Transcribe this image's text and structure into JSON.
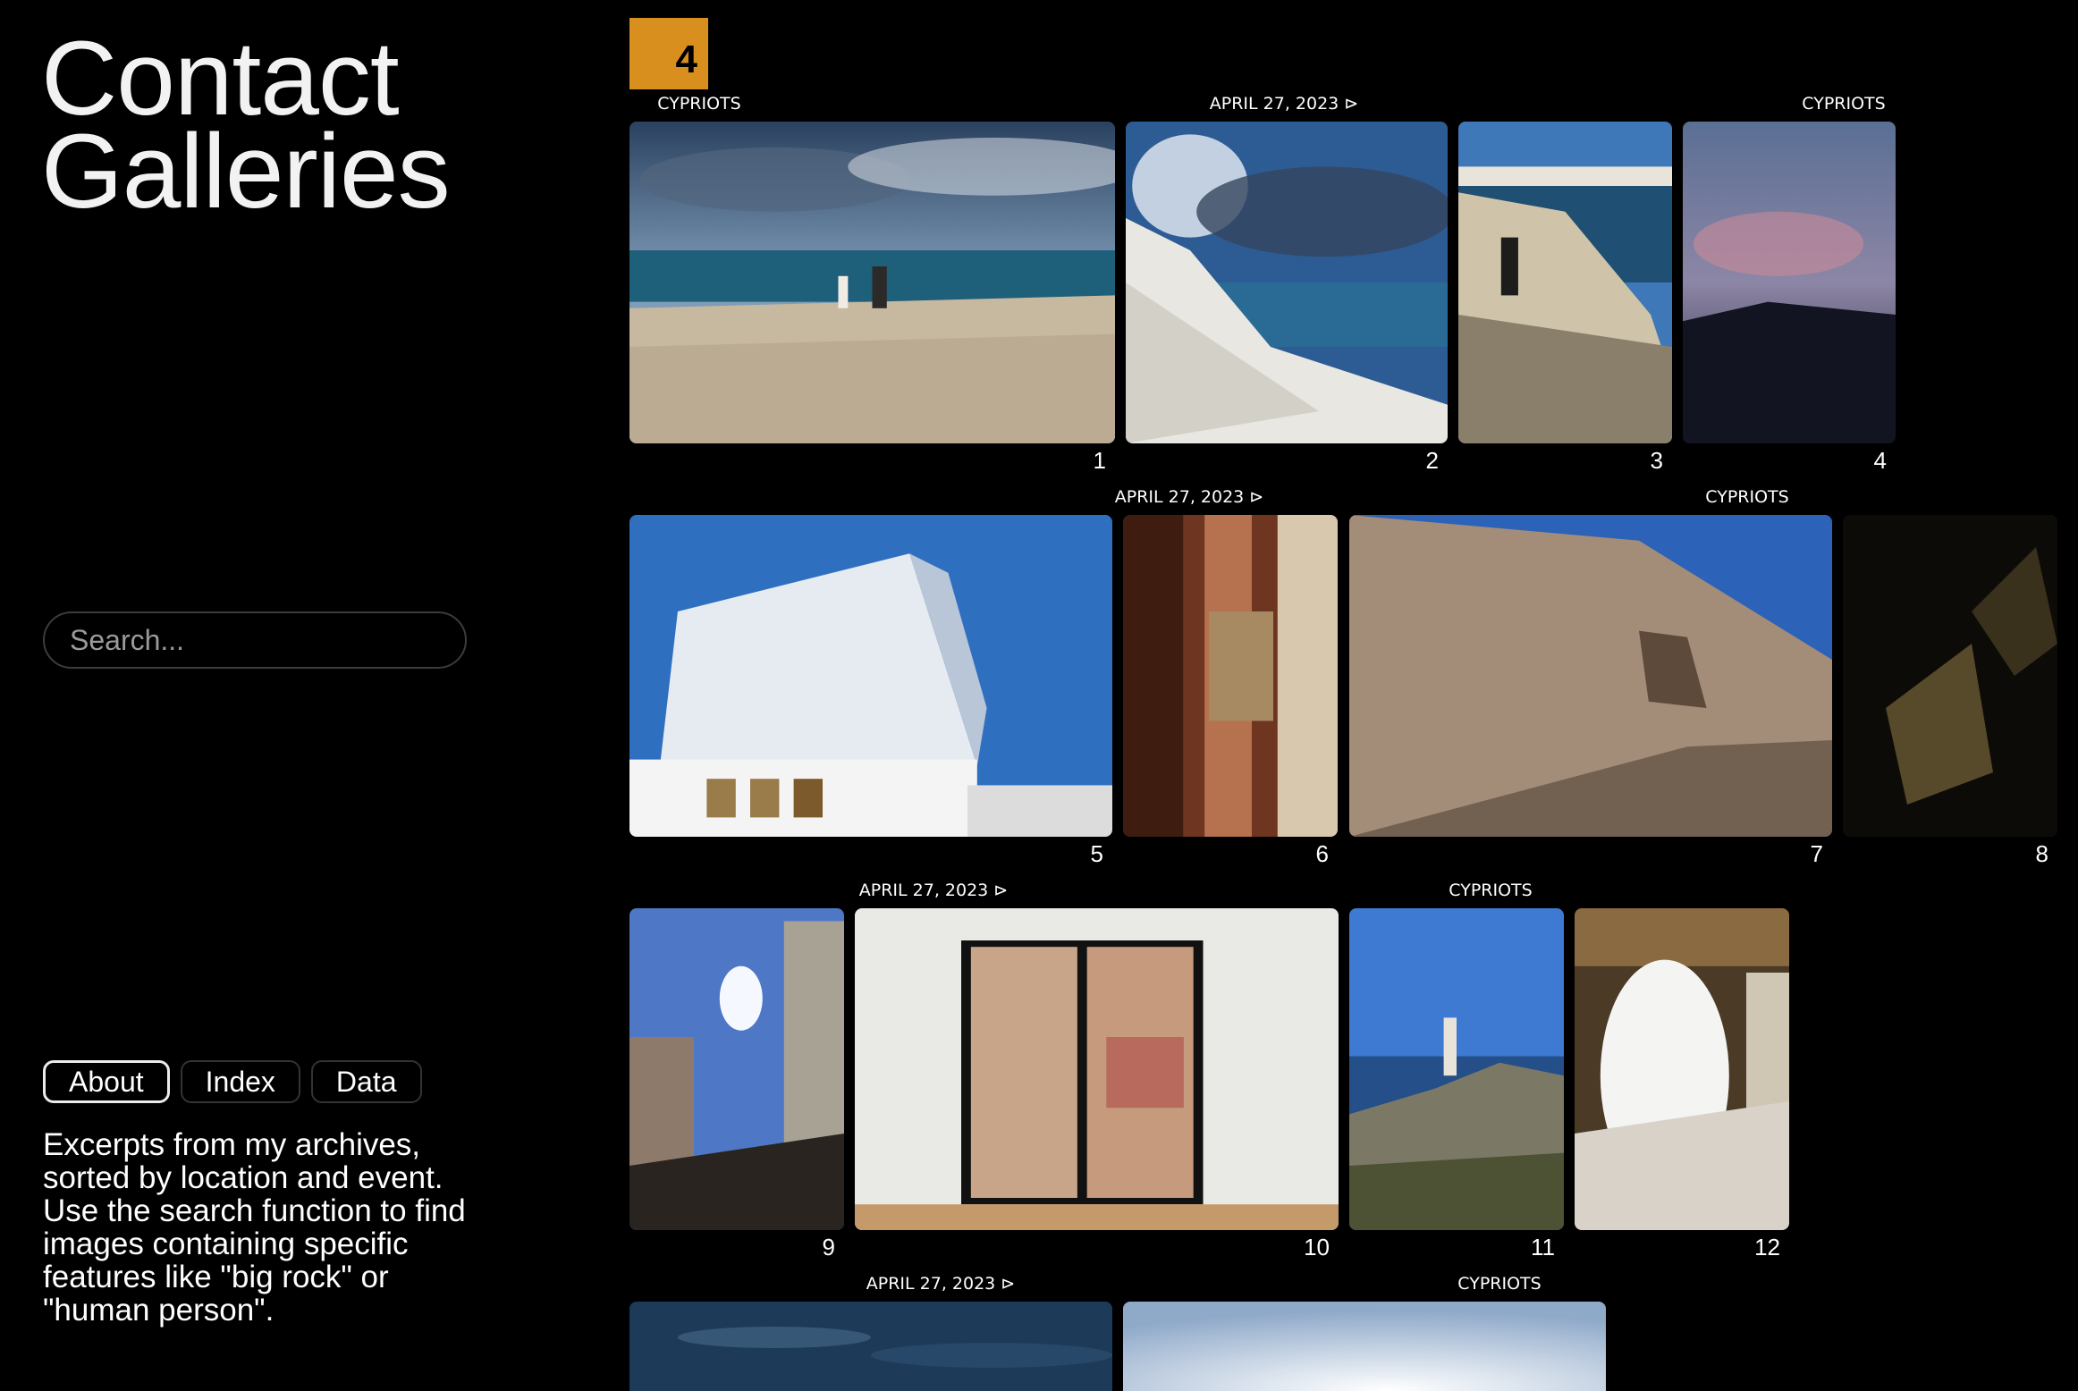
{
  "app": {
    "title": "Contact\nGalleries"
  },
  "search": {
    "placeholder": "Search..."
  },
  "tabs": [
    {
      "label": "About",
      "active": true
    },
    {
      "label": "Index",
      "active": false
    },
    {
      "label": "Data",
      "active": false
    }
  ],
  "about": {
    "text": "Excerpts from my archives, sorted by location and event. Use the search function to find images containing specific features like \"big rock\" or \"human person\"."
  },
  "badge": {
    "value": "4",
    "color": "#d98f1e"
  },
  "labels": {
    "date": "APRIL 27, 2023 ⊳",
    "location": "CYPRIOTS"
  },
  "photos": [
    {
      "number": "1",
      "scene": "seaside-cliff-people"
    },
    {
      "number": "2",
      "scene": "white-rock-coast"
    },
    {
      "number": "3",
      "scene": "person-on-rocks"
    },
    {
      "number": "4",
      "scene": "dusk-sky"
    },
    {
      "number": "5",
      "scene": "white-building"
    },
    {
      "number": "6",
      "scene": "building-detail"
    },
    {
      "number": "7",
      "scene": "stucco-wall-window"
    },
    {
      "number": "8",
      "scene": "dark-abstract"
    },
    {
      "number": "9",
      "scene": "sunny-street"
    },
    {
      "number": "10",
      "scene": "glass-door"
    },
    {
      "number": "11",
      "scene": "person-on-cliff"
    },
    {
      "number": "12",
      "scene": "arched-corridor"
    },
    {
      "number": "",
      "scene": "sea-water"
    },
    {
      "number": "",
      "scene": "bright-sky"
    }
  ]
}
